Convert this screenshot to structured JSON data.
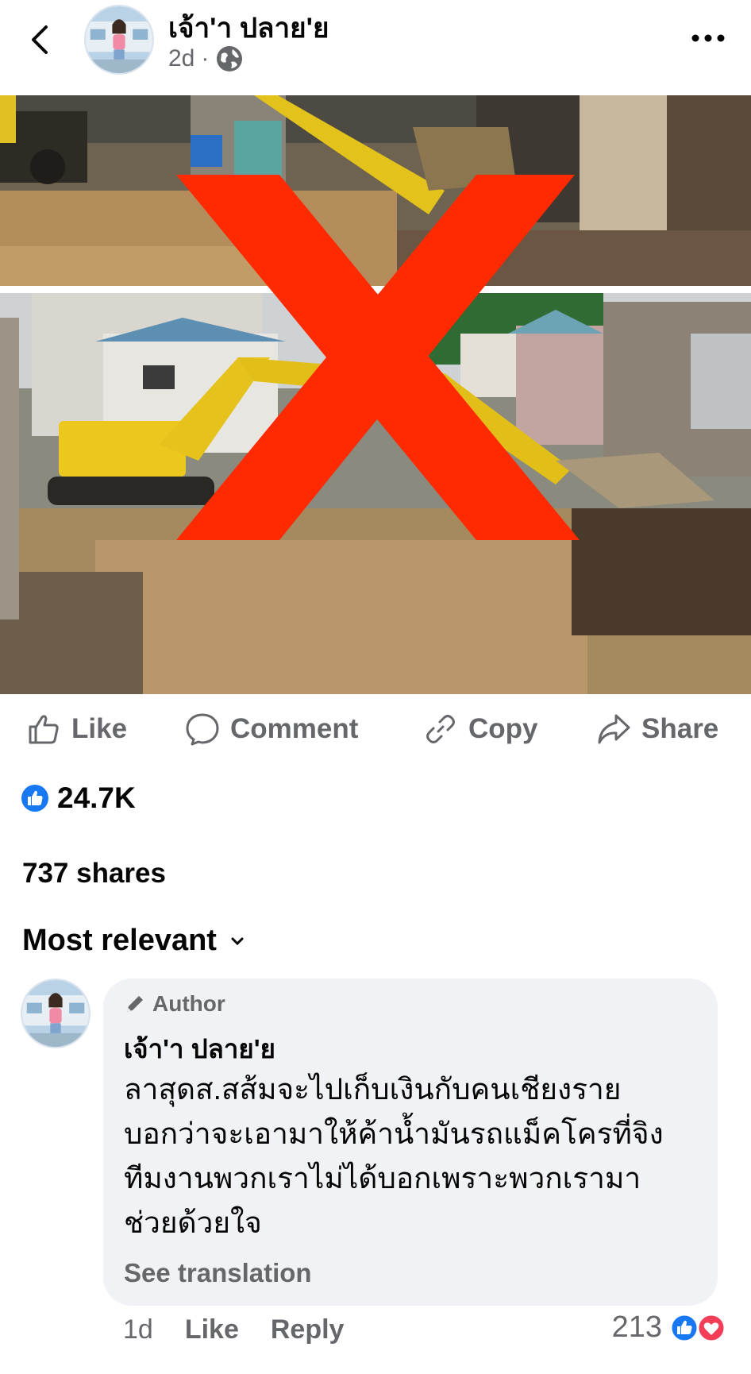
{
  "header": {
    "author_name": "เจ้า'า ปลาย'ย",
    "time": "2d",
    "separator": "·",
    "back_icon": "chevron-left-icon",
    "privacy_icon": "globe-icon",
    "more_icon": "more-dots-icon"
  },
  "actions": {
    "like": "Like",
    "comment": "Comment",
    "copy": "Copy",
    "share": "Share"
  },
  "stats": {
    "reaction_count": "24.7K",
    "shares": "737 shares"
  },
  "sort": {
    "label": "Most relevant"
  },
  "comment": {
    "badge": "Author",
    "name": "เจ้า'า ปลาย'ย",
    "lines": [
      "ลาสุดส.สส้มจะไปเก็บเงินกับคนเชียงราย",
      "บอกว่าจะเอามาให้ค้าน้ำมันรถแม็คโครที่จิง",
      "ทีมงานพวกเราไม่ได้บอกเพราะพวกเรามา",
      "ช่วยด้วยใจ"
    ],
    "see_translation": "See translation",
    "time": "1d",
    "like": "Like",
    "reply": "Reply",
    "reaction_count": "213"
  },
  "colors": {
    "fb_blue": "#1877f2",
    "love_red": "#f33e58",
    "x_mark": "#ff2a00",
    "muted": "#65676b",
    "bubble_bg": "#f0f2f5"
  }
}
